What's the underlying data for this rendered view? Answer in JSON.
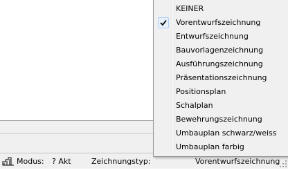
{
  "menu": {
    "items": [
      {
        "label": "KEINER",
        "checked": false
      },
      {
        "label": "Vorentwurfszeichnung",
        "checked": true
      },
      {
        "label": "Entwurfszeichnung",
        "checked": false
      },
      {
        "label": "Bauvorlagenzeichnung",
        "checked": false
      },
      {
        "label": "Ausführungszeichnung",
        "checked": false
      },
      {
        "label": "Präsentationszeichnung",
        "checked": false
      },
      {
        "label": "Positionsplan",
        "checked": false
      },
      {
        "label": "Schalplan",
        "checked": false
      },
      {
        "label": "Bewehrungszeichnung",
        "checked": false
      },
      {
        "label": "Umbauplan schwarz/weiss",
        "checked": false
      },
      {
        "label": "Umbauplan farbig",
        "checked": false
      }
    ],
    "check_icon": "checkmark-icon"
  },
  "statusbar": {
    "icon": "mode-icon",
    "modus_label": "Modus:",
    "modus_value": "? Akt",
    "zeichnungstyp_label": "Zeichnungstyp:",
    "zeichnungstyp_value": "Vorentwurfszeichnung"
  },
  "colors": {
    "menu_background": "#f0f0f0",
    "menu_border": "#979797",
    "check_frame": "#aecff7",
    "check_fill": "#e8f1fb",
    "statusbar_background": "#f0f0f0"
  }
}
